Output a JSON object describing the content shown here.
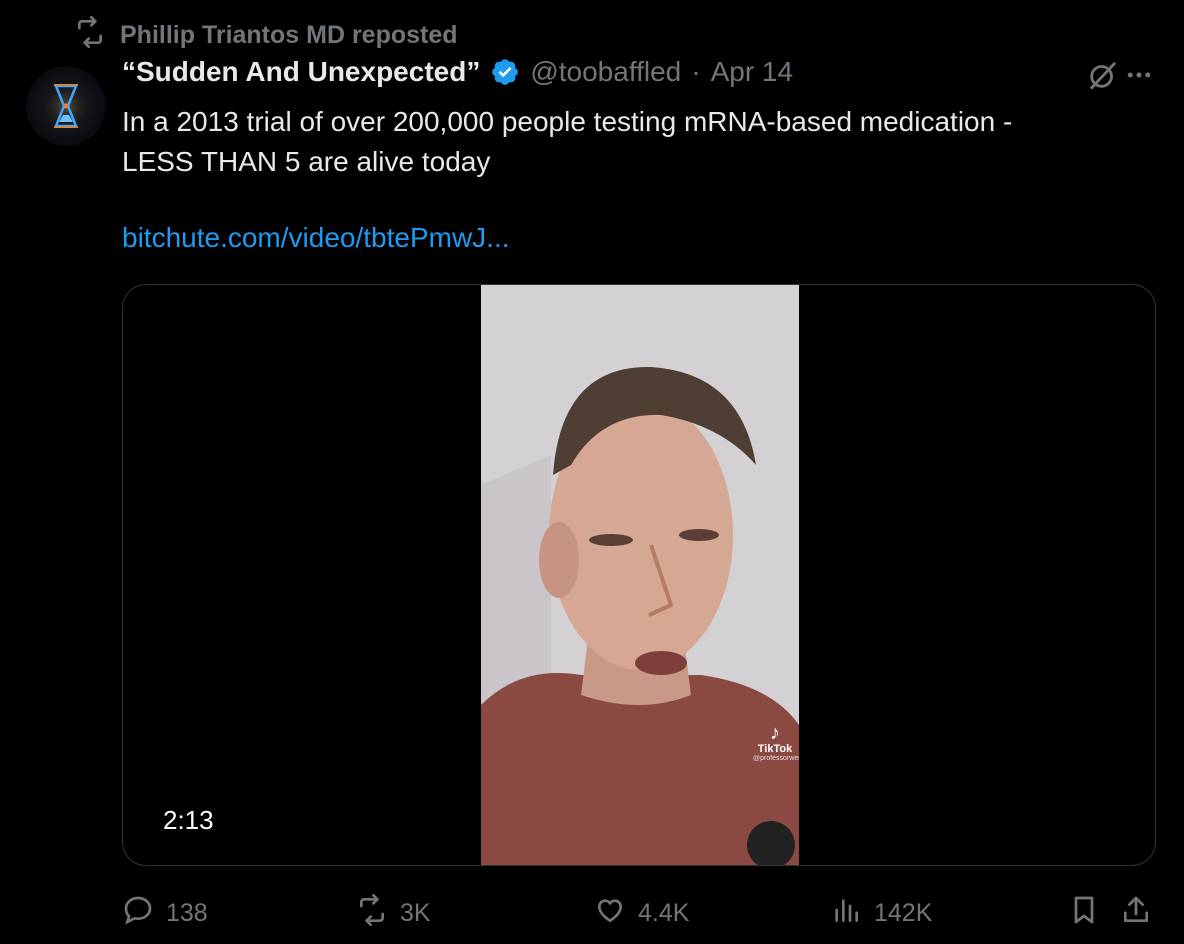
{
  "repost": {
    "label": "Phillip Triantos MD reposted",
    "icon": "repost-icon"
  },
  "author": {
    "name": "“Sudden And Unexpected”",
    "handle": "@toobaffled",
    "separator": "·",
    "date": "Apr 14",
    "verified": true,
    "verified_color": "#1d9bf0"
  },
  "tweet": {
    "text_line1": "In a 2013 trial of over 200,000 people testing mRNA-based medication -",
    "text_line2": "LESS THAN 5 are alive today",
    "link": "bitchute.com/video/tbtePmwJ..."
  },
  "media": {
    "duration": "2:13",
    "watermark": "TikTok",
    "watermark_handle": "@professorwendell"
  },
  "actions": {
    "replies": "138",
    "reposts": "3K",
    "likes": "4.4K",
    "views": "142K"
  },
  "colors": {
    "background": "#000000",
    "text": "#e7e9ea",
    "muted": "#71767b",
    "link": "#1d9bf0",
    "border": "#2f3336"
  }
}
